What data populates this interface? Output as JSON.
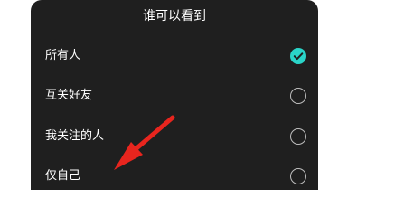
{
  "sheet": {
    "title": "谁可以看到",
    "options": [
      {
        "label": "所有人",
        "selected": true
      },
      {
        "label": "互关好友",
        "selected": false
      },
      {
        "label": "我关注的人",
        "selected": false
      },
      {
        "label": "仅自己",
        "selected": false
      }
    ]
  },
  "colors": {
    "sheet_background": "#1f1f1f",
    "selected_accent": "#2ad4c8",
    "annotation_arrow": "#e8251e"
  },
  "icons": {
    "selected": "check-circle-icon",
    "unselected": "radio-circle-icon",
    "annotation": "red-arrow-annotation"
  }
}
